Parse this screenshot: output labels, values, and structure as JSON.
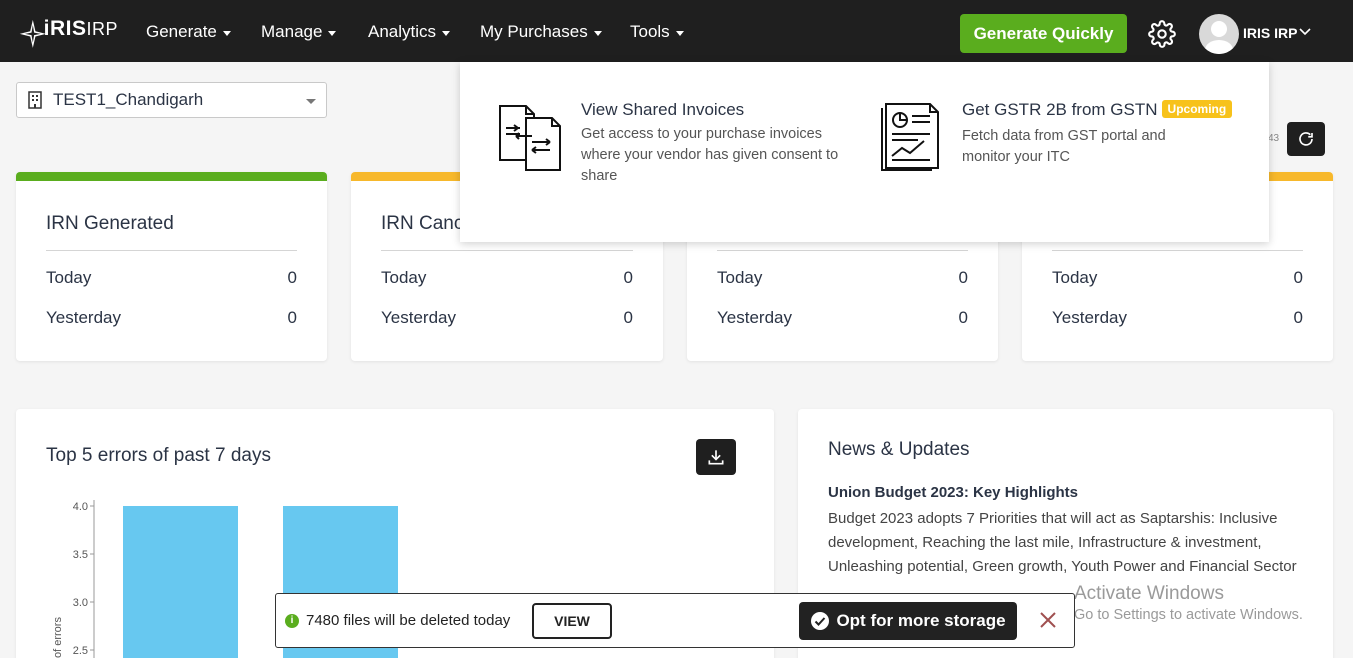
{
  "header": {
    "logo_main": "iRIS",
    "logo_sub": "IRP",
    "nav": [
      {
        "label": "Generate"
      },
      {
        "label": "Manage"
      },
      {
        "label": "Analytics"
      },
      {
        "label": "My Purchases"
      },
      {
        "label": "Tools"
      }
    ],
    "generate_quickly": "Generate Quickly",
    "user_name": "IRIS IRP"
  },
  "location": {
    "selected": "TEST1_Chandigarh"
  },
  "toolbar": {
    "partial_text": "43"
  },
  "cards": [
    {
      "title": "IRN Generated",
      "bar_color": "#5aad1e",
      "rows": [
        {
          "label": "Today",
          "value": "0"
        },
        {
          "label": "Yesterday",
          "value": "0"
        }
      ]
    },
    {
      "title": "IRN Canc",
      "bar_color": "#f7b82b",
      "rows": [
        {
          "label": "Today",
          "value": "0"
        },
        {
          "label": "Yesterday",
          "value": "0"
        }
      ]
    },
    {
      "title": "",
      "bar_color": "#5aad1e",
      "rows": [
        {
          "label": "Today",
          "value": "0"
        },
        {
          "label": "Yesterday",
          "value": "0"
        }
      ]
    },
    {
      "title": "",
      "bar_color": "#f7b82b",
      "rows": [
        {
          "label": "Today",
          "value": "0"
        },
        {
          "label": "Yesterday",
          "value": "0"
        }
      ]
    }
  ],
  "chart_panel": {
    "title": "Top 5 errors of past 7 days"
  },
  "chart_data": {
    "type": "bar",
    "title": "Top 5 errors of past 7 days",
    "ylabel": "of errors",
    "yticks": [
      "4.0",
      "3.5",
      "3.0",
      "2.5"
    ],
    "ylim": [
      2.5,
      4.0
    ],
    "categories": [
      "",
      ""
    ],
    "values": [
      4.0,
      4.0
    ],
    "bar_color": "#67c8f0"
  },
  "news": {
    "title": "News & Updates",
    "headline": "Union Budget 2023: Key Highlights",
    "body": "Budget 2023 adopts 7 Priorities that will act as Saptarshis: Inclusive development, Reaching the last mile, Infrastructure & investment, Unleashing potential, Green growth, Youth Power and Financial Sector"
  },
  "dropdown": {
    "items": [
      {
        "title": "View Shared Invoices",
        "desc": "Get access to your purchase invoices where your vendor has given consent to share"
      },
      {
        "title": "Get GSTR 2B from GSTN",
        "badge": "Upcoming",
        "desc": "Fetch data from GST portal and monitor your ITC"
      }
    ]
  },
  "watermark": {
    "line1": "Activate Windows",
    "line2": "Go to Settings to activate Windows."
  },
  "notification": {
    "message": "7480 files will be deleted today",
    "view_label": "VIEW",
    "storage_label": "Opt for more storage"
  }
}
